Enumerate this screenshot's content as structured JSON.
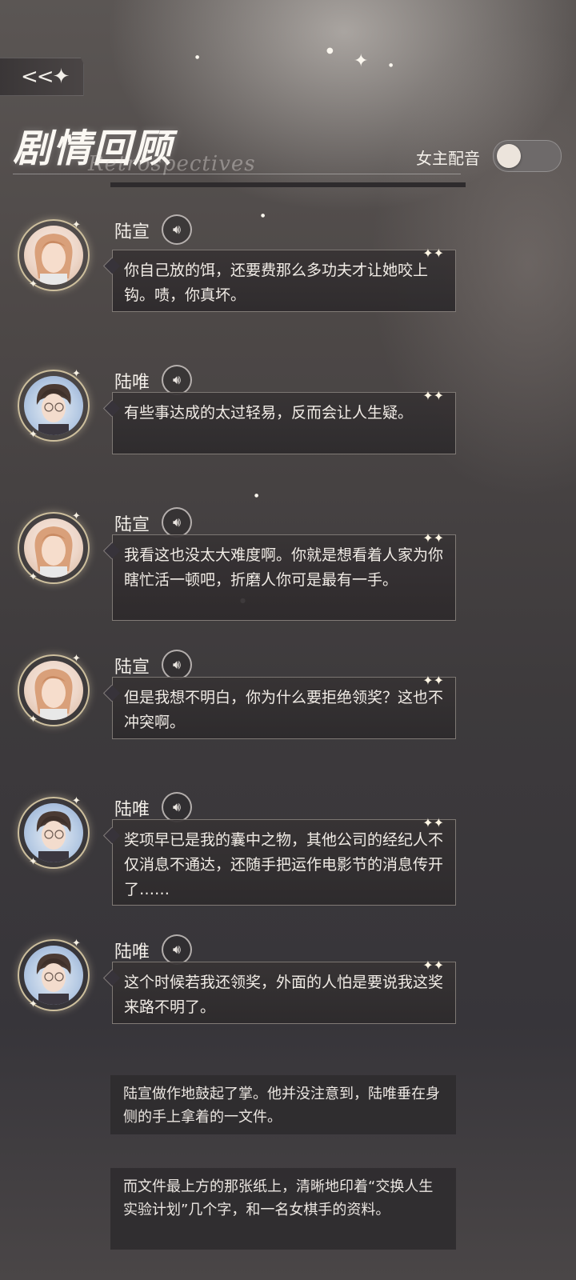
{
  "header": {
    "back_icon": "back-arrow-sparkle-icon",
    "title": "剧情回顾",
    "subtitle": "Retrospectives",
    "toggle_label": "女主配音",
    "toggle_on": false
  },
  "messages": [
    {
      "speaker": "陆宣",
      "avatar": "luxuan",
      "text": "你自己放的饵，还要费那么多功夫才让她咬上钩。啧，你真坏。"
    },
    {
      "speaker": "陆唯",
      "avatar": "luwei",
      "text": "有些事达成的太过轻易，反而会让人生疑。"
    },
    {
      "speaker": "陆宣",
      "avatar": "luxuan",
      "text": "我看这也没太大难度啊。你就是想看着人家为你瞎忙活一顿吧，折磨人你可是最有一手。"
    },
    {
      "speaker": "陆宣",
      "avatar": "luxuan",
      "text": "但是我想不明白，你为什么要拒绝领奖？这也不冲突啊。"
    },
    {
      "speaker": "陆唯",
      "avatar": "luwei",
      "text": "奖项早已是我的囊中之物，其他公司的经纪人不仅消息不通达，还随手把运作电影节的消息传开了……"
    },
    {
      "speaker": "陆唯",
      "avatar": "luwei",
      "text": "这个时候若我还领奖，外面的人怕是要说我这奖来路不明了。"
    }
  ],
  "narrations": [
    {
      "text": "陆宣做作地鼓起了掌。他并没注意到，陆唯垂在身侧的手上拿着的一文件。"
    },
    {
      "text": "而文件最上方的那张纸上，清晰地印着“交换人生实验计划”几个字，和一名女棋手的资料。"
    }
  ],
  "icons": {
    "voice": "voice-play-icon",
    "sparkle": "sparkle-icon"
  }
}
